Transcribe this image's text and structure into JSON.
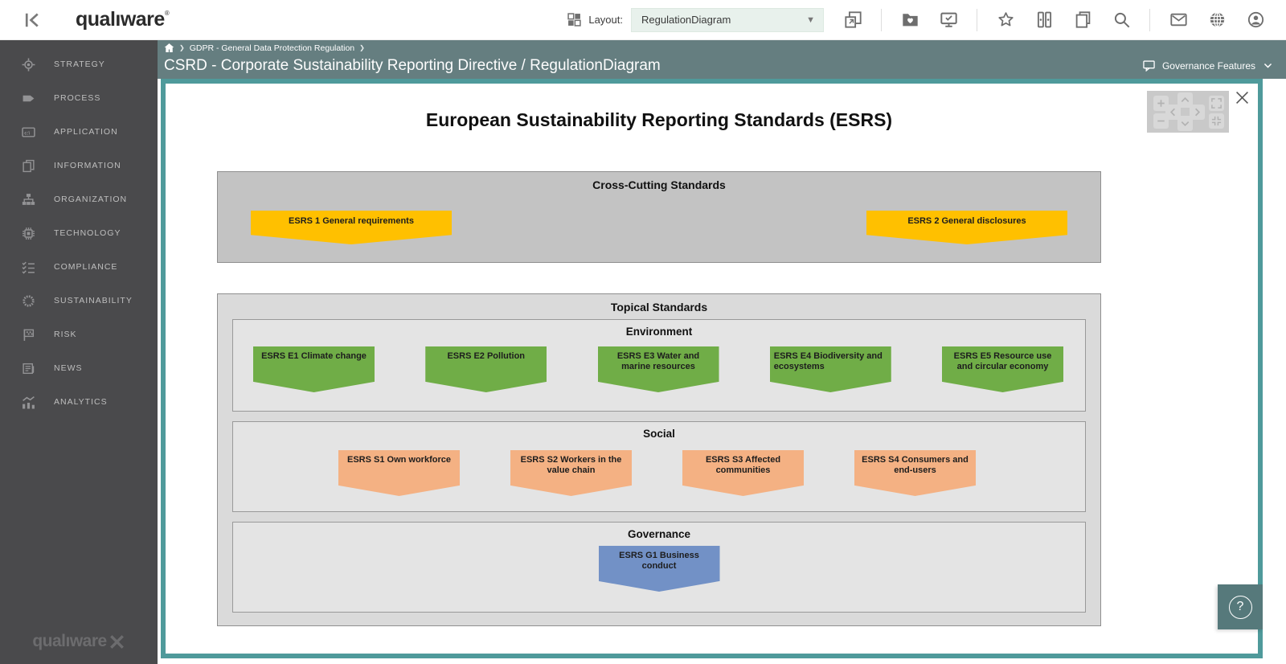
{
  "topbar": {
    "logo": "qualıware",
    "logo_reg": "®",
    "layout_label": "Layout:",
    "layout_value": "RegulationDiagram",
    "tools": [
      {
        "type": "icon",
        "name": "cascade-windows"
      },
      {
        "type": "divider"
      },
      {
        "type": "icon",
        "name": "favorites-folder"
      },
      {
        "type": "icon",
        "name": "monitor-check"
      },
      {
        "type": "divider"
      },
      {
        "type": "icon",
        "name": "star"
      },
      {
        "type": "icon",
        "name": "binders"
      },
      {
        "type": "icon",
        "name": "copy-documents"
      },
      {
        "type": "icon",
        "name": "search"
      },
      {
        "type": "divider"
      },
      {
        "type": "icon",
        "name": "mail"
      },
      {
        "type": "icon",
        "name": "globe"
      },
      {
        "type": "icon",
        "name": "user-account"
      }
    ]
  },
  "sidebar": {
    "items": [
      {
        "label": "STRATEGY",
        "icon": "strategy"
      },
      {
        "label": "PROCESS",
        "icon": "process"
      },
      {
        "label": "APPLICATION",
        "icon": "application"
      },
      {
        "label": "INFORMATION",
        "icon": "information"
      },
      {
        "label": "ORGANIZATION",
        "icon": "organization"
      },
      {
        "label": "TECHNOLOGY",
        "icon": "technology"
      },
      {
        "label": "COMPLIANCE",
        "icon": "compliance"
      },
      {
        "label": "SUSTAINABILITY",
        "icon": "sustainability"
      },
      {
        "label": "RISK",
        "icon": "risk"
      },
      {
        "label": "NEWS",
        "icon": "news"
      },
      {
        "label": "ANALYTICS",
        "icon": "analytics"
      }
    ],
    "footer_logo": "qualıware"
  },
  "breadcrumb": {
    "path": "GDPR - General Data Protection Regulation"
  },
  "title_bar": {
    "title": "CSRD - Corporate Sustainability Reporting Directive / RegulationDiagram",
    "right_label": "Governance Features"
  },
  "diagram": {
    "title": "European Sustainability Reporting Standards (ESRS)",
    "cross_cutting": {
      "title": "Cross-Cutting Standards",
      "color": "#FFC000",
      "items": [
        {
          "label": "ESRS 1 General requirements"
        },
        {
          "label": "ESRS 2 General disclosures"
        }
      ]
    },
    "topical": {
      "title": "Topical Standards",
      "sections": [
        {
          "key": "environment",
          "title": "Environment",
          "color": "#70AD47",
          "items": [
            {
              "label": "ESRS E1 Climate change"
            },
            {
              "label": "ESRS E2 Pollution"
            },
            {
              "label": "ESRS E3 Water and marine resources"
            },
            {
              "label": "ESRS E4 Biodiversity and ecosystems",
              "align": "left"
            },
            {
              "label": "ESRS E5 Resource use and circular economy"
            }
          ]
        },
        {
          "key": "social",
          "title": "Social",
          "color": "#F4B183",
          "items": [
            {
              "label": "ESRS S1 Own workforce"
            },
            {
              "label": "ESRS S2 Workers in the value chain"
            },
            {
              "label": "ESRS S3 Affected communities"
            },
            {
              "label": "ESRS S4 Consumers and end-users"
            }
          ]
        },
        {
          "key": "governance",
          "title": "Governance",
          "color": "#7291C6",
          "items": [
            {
              "label": "ESRS G1 Business conduct"
            }
          ]
        }
      ]
    },
    "nav_widget": [
      "zoom-in",
      "zoom-out",
      "pan-up",
      "pan-left",
      "pan-right",
      "pan-down",
      "fullscreen",
      "fit-view"
    ],
    "help_label": "?"
  },
  "colors": {
    "accent_teal": "#4F9A9B",
    "bar_teal": "#657E80",
    "sidebar_dark": "#4A4A4C",
    "cross_box_gray": "#C3C3C3",
    "topical_box_gray": "#DADADA",
    "section_box_gray": "#E4E4E4",
    "yellow": "#FFC000",
    "green": "#70AD47",
    "orange": "#F4B183",
    "blue": "#7291C6",
    "dropdown_green": "#E8F1EC"
  }
}
